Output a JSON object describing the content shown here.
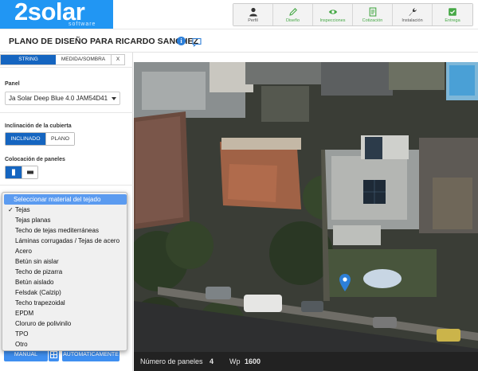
{
  "brand": {
    "name": "2solar",
    "tagline": "software",
    "color": "#2196f3"
  },
  "nav": [
    {
      "label": "Perfil",
      "icon": "user-icon"
    },
    {
      "label": "Diseño",
      "icon": "pencil-icon"
    },
    {
      "label": "Inspecciones",
      "icon": "eye-icon"
    },
    {
      "label": "Cotización",
      "icon": "document-icon"
    },
    {
      "label": "Instalación",
      "icon": "wrench-icon"
    },
    {
      "label": "Entrega",
      "icon": "checkbox-icon"
    }
  ],
  "page": {
    "title": "PLANO DE DISEÑO PARA RICARDO SANCHEZ"
  },
  "left_panel": {
    "tabs": {
      "string": "STRING",
      "shade": "MEDIDA/SOMBRA",
      "close": "X"
    },
    "panel_label": "Panel",
    "panel_value": "Ja Solar Deep Blue 4.0 JAM54D41",
    "roof_tilt_label": "Inclinación de la cubierta",
    "roof_tilt_options": [
      "INCLINADO",
      "PLANO"
    ],
    "roof_tilt_selected": "INCLINADO",
    "placement_label": "Colocación de paneles",
    "placement_selected": "portrait",
    "material_options": [
      "Seleccionar material del tejado",
      "Tejas",
      "Tejas planas",
      "Techo de tejas mediterráneas",
      "Láminas corrugadas / Tejas de acero",
      "Acero",
      "Betún sin aislar",
      "Techo de pizarra",
      "Betún aislado",
      "Felsdak (Calzip)",
      "Techo trapezoidal",
      "EPDM",
      "Cloruro de polivinilo",
      "TPO",
      "Otro"
    ],
    "material_selected": "Tejas",
    "bottom_buttons": {
      "manual": "MANUAL",
      "auto": "AUTOMATICAMENTE"
    }
  },
  "status": {
    "panels_label": "Número de paneles",
    "panels_value": "4",
    "wp_label": "Wp",
    "wp_value": "1600"
  },
  "colors": {
    "primary": "#1565c0",
    "highlight": "#5b9bf0",
    "marker": "#2d7fd8"
  }
}
